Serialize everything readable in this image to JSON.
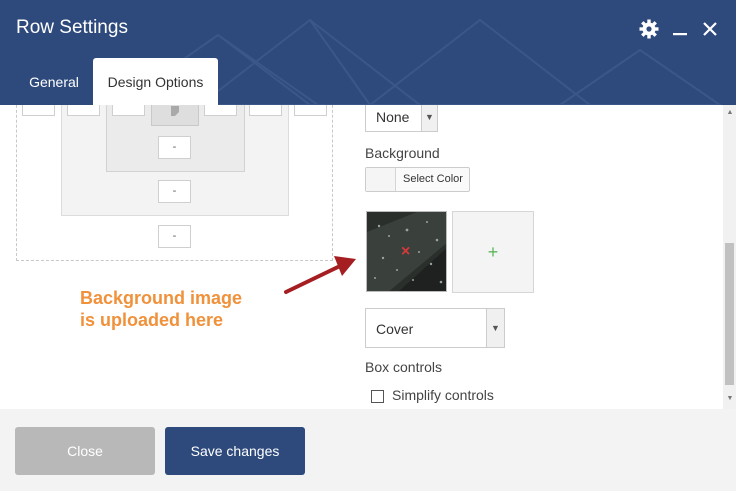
{
  "header": {
    "title": "Row Settings",
    "icons": [
      "gear-icon",
      "minimize-icon",
      "close-icon"
    ],
    "bg_color": "#2e4a7c"
  },
  "tabs": [
    {
      "label": "General",
      "active": false
    },
    {
      "label": "Design Options",
      "active": true
    }
  ],
  "box_model": {
    "inputs": [
      "-",
      "-",
      "-"
    ]
  },
  "design": {
    "border_style_value": "None",
    "background_label": "Background",
    "select_color_label": "Select Color",
    "add_image_symbol": "+",
    "remove_image_symbol": "×",
    "background_style_value": "Cover",
    "box_controls_label": "Box controls",
    "simplify_controls_label": "Simplify controls",
    "simplify_checked": false
  },
  "annotation": {
    "line1": "Background image",
    "line2": "is uploaded here",
    "color": "#f0913b"
  },
  "footer": {
    "close_label": "Close",
    "save_label": "Save changes"
  }
}
